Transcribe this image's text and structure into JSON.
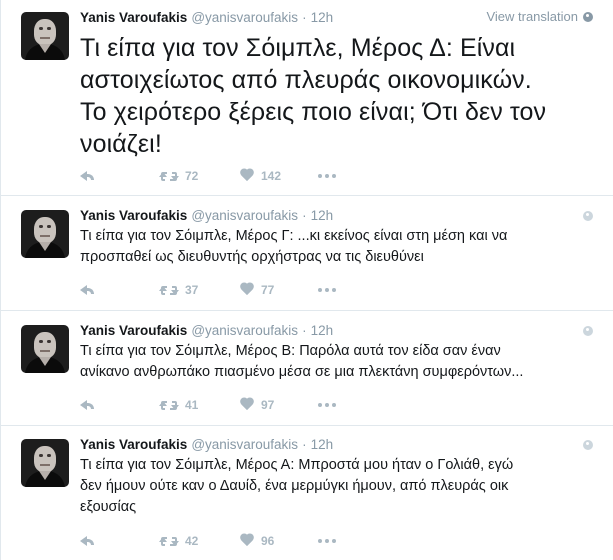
{
  "colors": {
    "text": "#14171a",
    "secondary": "#8899a6",
    "action_icons": "#aab8c2",
    "divider": "#e1e8ed"
  },
  "tweets": [
    {
      "author_name": "Yanis Varoufakis",
      "handle": "@yanisvaroufakis",
      "separator": "·",
      "time": "12h",
      "view_translation": "View translation",
      "text_lines": [
        "Τι είπα για τον Σόιμπλε, Μέρος Δ: Είναι",
        "αστοιχείωτος από πλευράς οικονομικών.",
        "Το χειρότερο ξέρεις ποιο είναι; Ότι δεν τον",
        "νοιάζει!"
      ],
      "retweets": "72",
      "likes": "142",
      "icons": [
        "reply-icon",
        "retweet-icon",
        "heart-icon",
        "more-icon",
        "globe-icon"
      ]
    },
    {
      "author_name": "Yanis Varoufakis",
      "handle": "@yanisvaroufakis",
      "separator": "·",
      "time": "12h",
      "text_lines": [
        "Τι είπα για τον Σόιμπλε, Μέρος Γ: ...κι εκείνος είναι στη μέση και να",
        "προσπαθεί ως διευθυντής ορχήστρας να τις διευθύνει"
      ],
      "retweets": "37",
      "likes": "77"
    },
    {
      "author_name": "Yanis Varoufakis",
      "handle": "@yanisvaroufakis",
      "separator": "·",
      "time": "12h",
      "text_lines": [
        "Τι είπα για τον Σόιμπλε, Μέρος Β: Παρόλα αυτά τον είδα σαν έναν",
        "ανίκανο ανθρωπάκο πιασμένο μέσα σε μια πλεκτάνη συμφερόντων..."
      ],
      "retweets": "41",
      "likes": "97"
    },
    {
      "author_name": "Yanis Varoufakis",
      "handle": "@yanisvaroufakis",
      "separator": "·",
      "time": "12h",
      "text_lines": [
        "Τι είπα για τον Σόιμπλε, Μέρος Α: Μπροστά μου ήταν ο Γολιάθ, εγώ",
        "δεν ήμουν ούτε καν ο Δαυίδ, ένα μερμύγκι ήμουν, από πλευράς οικ",
        "εξουσίας"
      ],
      "retweets": "42",
      "likes": "96"
    }
  ]
}
